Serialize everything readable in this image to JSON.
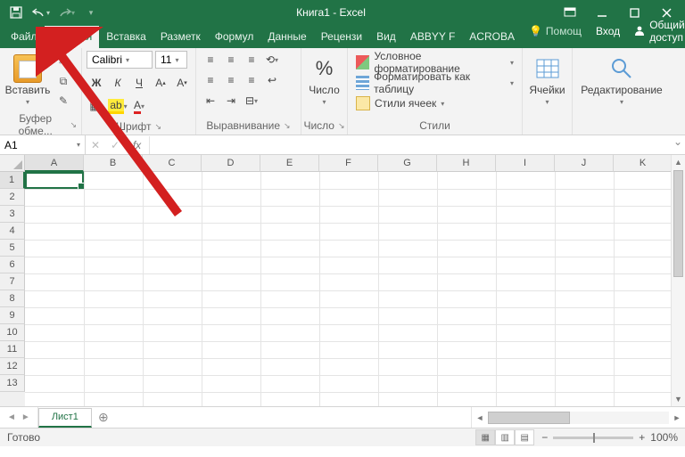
{
  "title": "Книга1 - Excel",
  "qat": {
    "save": "save",
    "undo": "undo",
    "redo": "redo"
  },
  "tabs": {
    "file": "Файл",
    "home": "Главная",
    "insert": "Вставка",
    "layout": "Разметк",
    "formulas": "Формул",
    "data": "Данные",
    "review": "Рецензи",
    "view": "Вид",
    "abbyy": "ABBYY F",
    "acrobat": "ACROBA"
  },
  "help": "Помощ",
  "login": "Вход",
  "share": "Общий доступ",
  "ribbon": {
    "clipboard": {
      "paste": "Вставить",
      "label": "Буфер обме..."
    },
    "font": {
      "name": "Calibri",
      "size": "11",
      "label": "Шрифт",
      "bold": "Ж",
      "italic": "К",
      "underline": "Ч"
    },
    "align": {
      "label": "Выравнивание"
    },
    "number": {
      "btn": "Число",
      "label": "Число"
    },
    "styles": {
      "cf": "Условное форматирование",
      "table": "Форматировать как таблицу",
      "cell": "Стили ячеек",
      "label": "Стили"
    },
    "cells": {
      "btn": "Ячейки"
    },
    "editing": {
      "btn": "Редактирование"
    }
  },
  "namebox": "A1",
  "columns": [
    "A",
    "B",
    "C",
    "D",
    "E",
    "F",
    "G",
    "H",
    "I",
    "J",
    "K"
  ],
  "rows": [
    "1",
    "2",
    "3",
    "4",
    "5",
    "6",
    "7",
    "8",
    "9",
    "10",
    "11",
    "12",
    "13"
  ],
  "sheet": "Лист1",
  "status": "Готово",
  "zoom": "100%"
}
